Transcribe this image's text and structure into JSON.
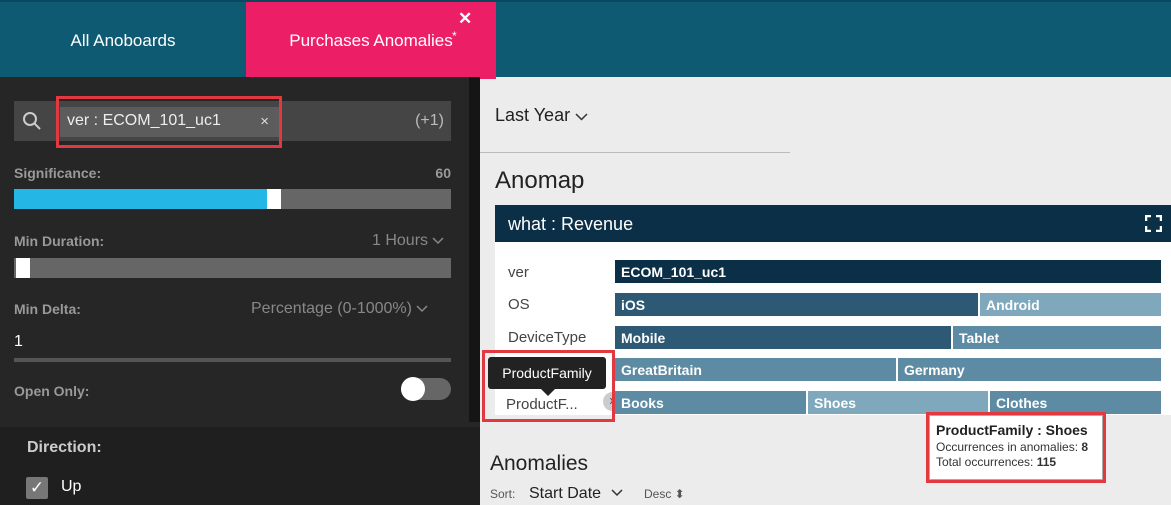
{
  "tabs": [
    {
      "label": "All Anoboards"
    },
    {
      "label": "Purchases Anomalies",
      "modified": "*"
    }
  ],
  "filters": {
    "search_chip": "ver : ECOM_101_uc1",
    "chip_remove": "×",
    "more_count": "(+1)",
    "significance": {
      "label": "Significance:",
      "value": "60",
      "level_fraction": 0.6
    },
    "min_duration": {
      "label": "Min Duration:",
      "value": "1 Hours",
      "level_fraction": 0
    },
    "min_delta": {
      "label": "Min Delta:",
      "unit": "Percentage (0-1000%)",
      "value": "1"
    },
    "open_only": {
      "label": "Open Only:",
      "on": false
    },
    "direction": {
      "label": "Direction:",
      "options": [
        {
          "label": "Up",
          "checked": true
        }
      ]
    }
  },
  "main": {
    "period": "Last Year",
    "anomap": {
      "title": "Anomap",
      "card_title": "what : Revenue",
      "rows": [
        {
          "label": "ver",
          "segments": [
            {
              "name": "ECOM_101_uc1",
              "color": "#0b2f46"
            }
          ]
        },
        {
          "label": "OS",
          "segments": [
            {
              "name": "iOS",
              "color": "#2d5974"
            },
            {
              "name": "Android",
              "color": "#7fa8bd"
            }
          ]
        },
        {
          "label": "DeviceType",
          "segments": [
            {
              "name": "Mobile",
              "color": "#2d5974"
            },
            {
              "name": "Tablet",
              "color": "#5d8ba3"
            }
          ]
        },
        {
          "label": "ProductFamily (tooltip row)",
          "segments": [
            {
              "name": "GreatBritain",
              "color": "#5d8ba3"
            },
            {
              "name": "Germany",
              "color": "#5d8ba3"
            }
          ]
        },
        {
          "label": "ProductF...",
          "segments": [
            {
              "name": "Books",
              "color": "#5d8ba3"
            },
            {
              "name": "Shoes",
              "color": "#7fa8bd"
            },
            {
              "name": "Clothes",
              "color": "#5d8ba3"
            }
          ]
        }
      ],
      "tooltip": "ProductFamily",
      "remove_x": "x",
      "popup": {
        "title": "ProductFamily : Shoes",
        "occ_label": "Occurrences in anomalies:",
        "occ_value": "8",
        "total_label": "Total occurrences:",
        "total_value": "115"
      }
    },
    "anomalies": {
      "title": "Anomalies",
      "sort_label": "Sort:",
      "sort_value": "Start Date",
      "order": "Desc ⬍"
    }
  },
  "colors": {
    "topbar": "#0e5a73",
    "active_tab": "#ec1f66",
    "slider_fill": "#24b7e6",
    "highlight": "#e2383f"
  }
}
